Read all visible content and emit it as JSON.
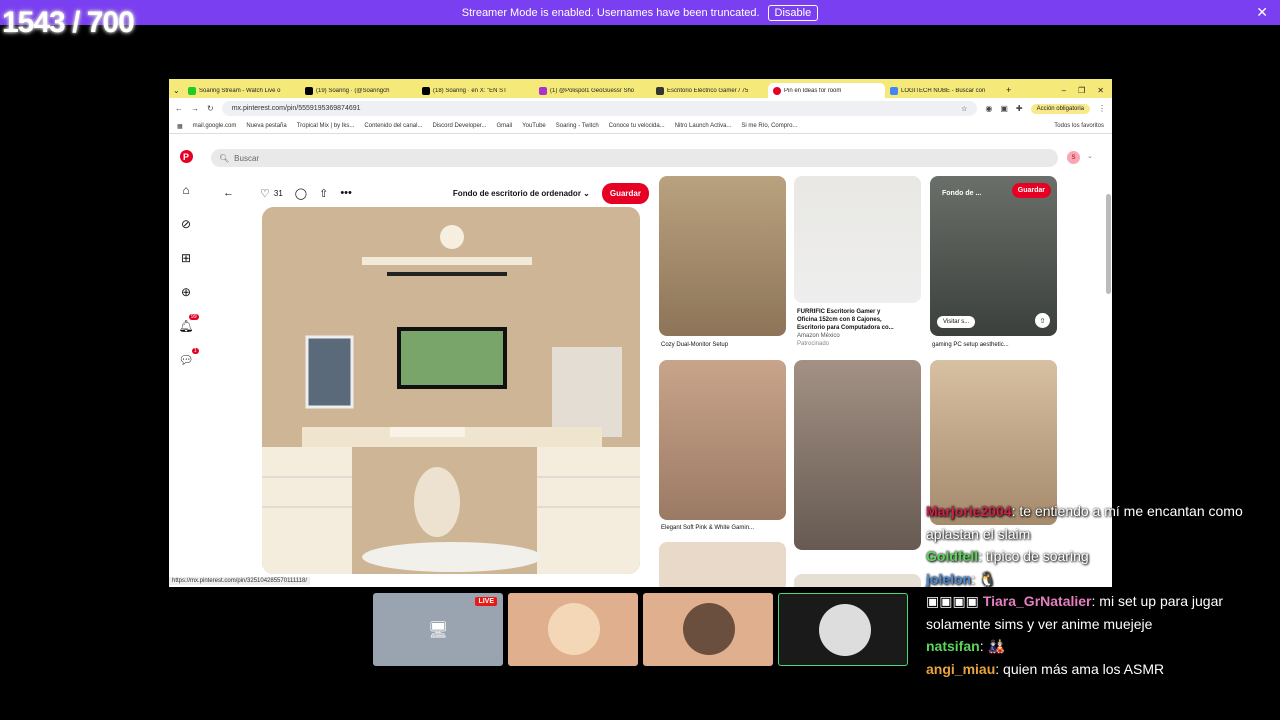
{
  "overlay": {
    "counter": "1543 / 700"
  },
  "banner": {
    "text": "Streamer Mode is enabled. Usernames have been truncated.",
    "button": "Disable"
  },
  "browser": {
    "tabs": [
      {
        "label": "Soaring Stream - Watch Live o",
        "color": "#2c2"
      },
      {
        "label": "(19) Soaring · (@Soaringch",
        "color": "#000"
      },
      {
        "label": "(18) Soaring · en X: \"EN ST",
        "color": "#000"
      },
      {
        "label": "(1) @Polispol1 GeoGuessr Sho",
        "color": "#a3c"
      },
      {
        "label": "Escritorio Eléctrico Gamer / 75",
        "color": "#333"
      },
      {
        "label": "Pin en Ideas for room",
        "color": "#e60023"
      },
      {
        "label": "LOGITECH NUBE - Buscar con",
        "color": "#4285f4"
      }
    ],
    "url": "mx.pinterest.com/pin/5559195369874691",
    "action_label": "Acción obligatoria",
    "bookmarks": [
      "mail.google.com",
      "Nueva pestaña",
      "Tropical Mix | by Iks...",
      "Contenido del canal...",
      "Discord Developer...",
      "Gmail",
      "YouTube",
      "Soaring - Twitch",
      "Conoce tu velocida...",
      "Nitro Launch Activa...",
      "Si me Río, Compro..."
    ],
    "bookmarks_end": "Todos los favoritos"
  },
  "pinterest": {
    "search_placeholder": "Buscar",
    "avatar_letter": "S",
    "notif_badge": "99",
    "msg_badge": "1",
    "likes": "31",
    "board": "Fondo de escritorio de ordenador",
    "save": "Guardar",
    "grid": {
      "c1": "Cozy Dual-Monitor Setup",
      "c2_title1": "FURRIFIC Escritorio Gamer y",
      "c2_title2": "Oficina 152cm con 8 Cajones,",
      "c2_title3": "Escritorio para Computadora co...",
      "c2_store": "Amazon México",
      "c2_sponsored": "Patrocinado",
      "c3": "gaming PC setup aesthetic...",
      "c3_board": "Fondo de ...",
      "c3_save": "Guardar",
      "c3_visit": "Visitar s...",
      "c4": "Elegant Soft Pink & White Gamin..."
    }
  },
  "status_url": "https://mx.pinterest.com/pin/325104285570111118/",
  "cams": {
    "live": "LIVE"
  },
  "chat": [
    {
      "user": "Marjorie2004",
      "color": "#d1224a",
      "msg": ": te entiendo a mí me encantan como aplastan el slaim"
    },
    {
      "user": "Goldfell",
      "color": "#5dd55d",
      "msg": ": típico de soaring"
    },
    {
      "user": "jolelon",
      "color": "#4b8bd8",
      "msg": ": 🐧"
    },
    {
      "user": "Tiara_GrNatalier",
      "color": "#e67ec0",
      "msg": ": mi set up para jugar solamente sims y ver anime muejeje"
    },
    {
      "user": "natsifan",
      "color": "#5dd55d",
      "msg": ": 🎎"
    },
    {
      "user": "angi_miau",
      "color": "#e8a33d",
      "msg": ": quien más ama los ASMR"
    }
  ]
}
